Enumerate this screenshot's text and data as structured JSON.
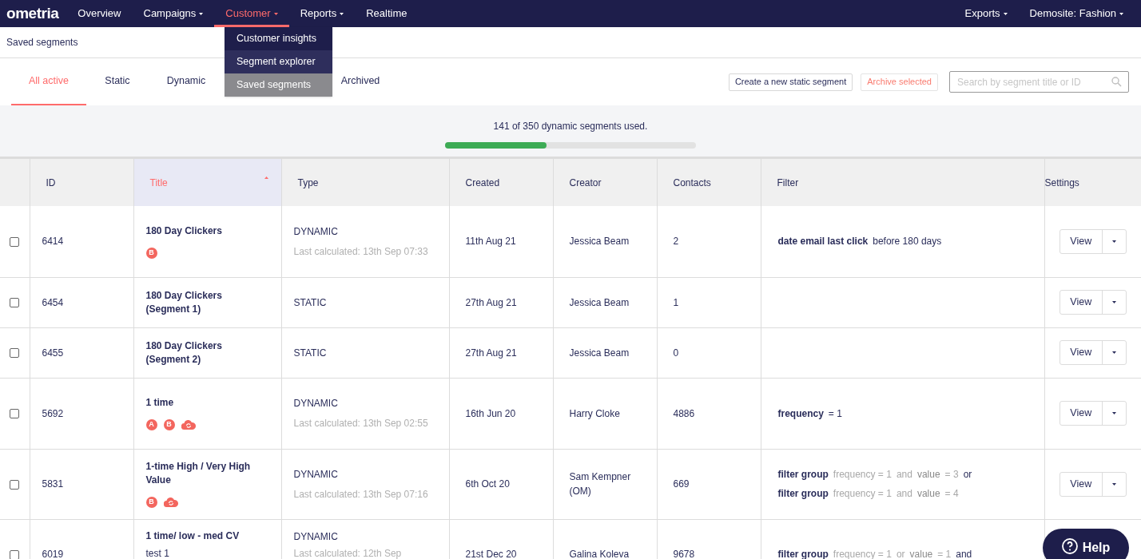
{
  "nav": {
    "logo": "ometria",
    "items": [
      {
        "label": "Overview",
        "caret": false,
        "selected": false
      },
      {
        "label": "Campaigns",
        "caret": true,
        "selected": false
      },
      {
        "label": "Customer",
        "caret": true,
        "selected": true
      },
      {
        "label": "Reports",
        "caret": true,
        "selected": false
      },
      {
        "label": "Realtime",
        "caret": false,
        "selected": false
      }
    ],
    "right_items": [
      {
        "label": "Exports",
        "caret": true
      },
      {
        "label": "Demosite: Fashion",
        "caret": true
      }
    ]
  },
  "dropdown": [
    {
      "label": "Customer insights",
      "selected": false
    },
    {
      "label": "Segment explorer",
      "selected": false
    },
    {
      "label": "Saved segments",
      "selected": true
    }
  ],
  "breadcrumb": "Saved segments",
  "tabs": [
    {
      "label": "All active",
      "selected": true
    },
    {
      "label": "Static",
      "selected": false
    },
    {
      "label": "Dynamic",
      "selected": false
    },
    {
      "label": "Archived",
      "selected": false
    }
  ],
  "actions": {
    "create": "Create a new static segment",
    "archive": "Archive selected",
    "search": {
      "placeholder": "Search by segment title or ID"
    }
  },
  "usage": {
    "text": "141 of 350 dynamic segments used.",
    "level": 0.403
  },
  "table": {
    "columns": [
      {
        "label": "ID",
        "sorted": false
      },
      {
        "label": "Title",
        "sorted": true
      },
      {
        "label": "Type",
        "sorted": false
      },
      {
        "label": "Created",
        "sorted": false
      },
      {
        "label": "Creator",
        "sorted": false
      },
      {
        "label": "Contacts",
        "sorted": false
      },
      {
        "label": "Filter",
        "sorted": false
      },
      {
        "label": "Settings",
        "sorted": false
      }
    ],
    "rows": [
      {
        "checked": false,
        "id": "6414",
        "title": "180 Day Clickers",
        "badges": [
          {
            "kind": "letter",
            "text": "B"
          }
        ],
        "type": "DYNAMIC",
        "calculated": "Last calculated: 13th Sep 07:33",
        "created": "11th Aug 21",
        "creator": "Jessica Beam",
        "contacts": "2",
        "filter": [
          [
            {
              "kind": "strong",
              "text": "date email last click"
            },
            {
              "kind": "plain",
              "text": "before 180 days"
            }
          ]
        ],
        "view": "View"
      },
      {
        "checked": false,
        "id": "6454",
        "title": "180 Day Clickers (Segment 1)",
        "badges": [],
        "type": "STATIC",
        "created": "27th Aug 21",
        "creator": "Jessica Beam",
        "contacts": "1",
        "filter": [],
        "view": "View"
      },
      {
        "checked": false,
        "id": "6455",
        "title": "180 Day Clickers (Segment 2)",
        "badges": [],
        "type": "STATIC",
        "created": "27th Aug 21",
        "creator": "Jessica Beam",
        "contacts": "0",
        "filter": [],
        "view": "View"
      },
      {
        "checked": false,
        "id": "5692",
        "title": "1 time",
        "badges": [
          {
            "kind": "letter",
            "text": "A"
          },
          {
            "kind": "letter",
            "text": "B"
          },
          {
            "kind": "sync"
          }
        ],
        "type": "DYNAMIC",
        "calculated": "Last calculated: 13th Sep 02:55",
        "created": "16th Jun 20",
        "creator": "Harry Cloke",
        "contacts": "4886",
        "filter": [
          [
            {
              "kind": "strong",
              "text": "frequency"
            },
            {
              "kind": "plain",
              "text": "= 1"
            }
          ]
        ],
        "view": "View"
      },
      {
        "checked": false,
        "id": "5831",
        "title": "1-time High / Very High Value",
        "badges": [
          {
            "kind": "letter",
            "text": "B"
          },
          {
            "kind": "sync"
          }
        ],
        "type": "DYNAMIC",
        "calculated": "Last calculated: 13th Sep 07:16",
        "created": "6th Oct 20",
        "creator": "Sam Kempner (OM)",
        "contacts": "669",
        "filter": [
          [
            {
              "kind": "strong",
              "text": "filter group"
            },
            {
              "kind": "dim",
              "text": "frequency = 1"
            },
            {
              "kind": "dim",
              "text": "and"
            },
            {
              "kind": "mid",
              "text": "value"
            },
            {
              "kind": "dim",
              "text": "= 3"
            },
            {
              "kind": "plain",
              "text": "or"
            }
          ],
          [
            {
              "kind": "strong",
              "text": "filter group"
            },
            {
              "kind": "dim",
              "text": "frequency = 1"
            },
            {
              "kind": "dim",
              "text": "and"
            },
            {
              "kind": "mid",
              "text": "value"
            },
            {
              "kind": "dim",
              "text": "= 4"
            }
          ]
        ],
        "view": "View"
      },
      {
        "checked": false,
        "id": "6019",
        "title": "1 time/ low - med CV",
        "subtitle": "test 1",
        "badges": [],
        "type": "DYNAMIC",
        "calculated": "Last calculated: 12th Sep",
        "created": "21st Dec 20",
        "creator": "Galina Koleva",
        "contacts": "9678",
        "filter": [
          [
            {
              "kind": "strong",
              "text": "filter group"
            },
            {
              "kind": "dim",
              "text": "frequency = 1"
            },
            {
              "kind": "dim",
              "text": "or"
            },
            {
              "kind": "mid",
              "text": "value"
            },
            {
              "kind": "dim",
              "text": "= 1"
            },
            {
              "kind": "plain",
              "text": "and"
            }
          ]
        ]
      }
    ]
  },
  "help": "Help"
}
